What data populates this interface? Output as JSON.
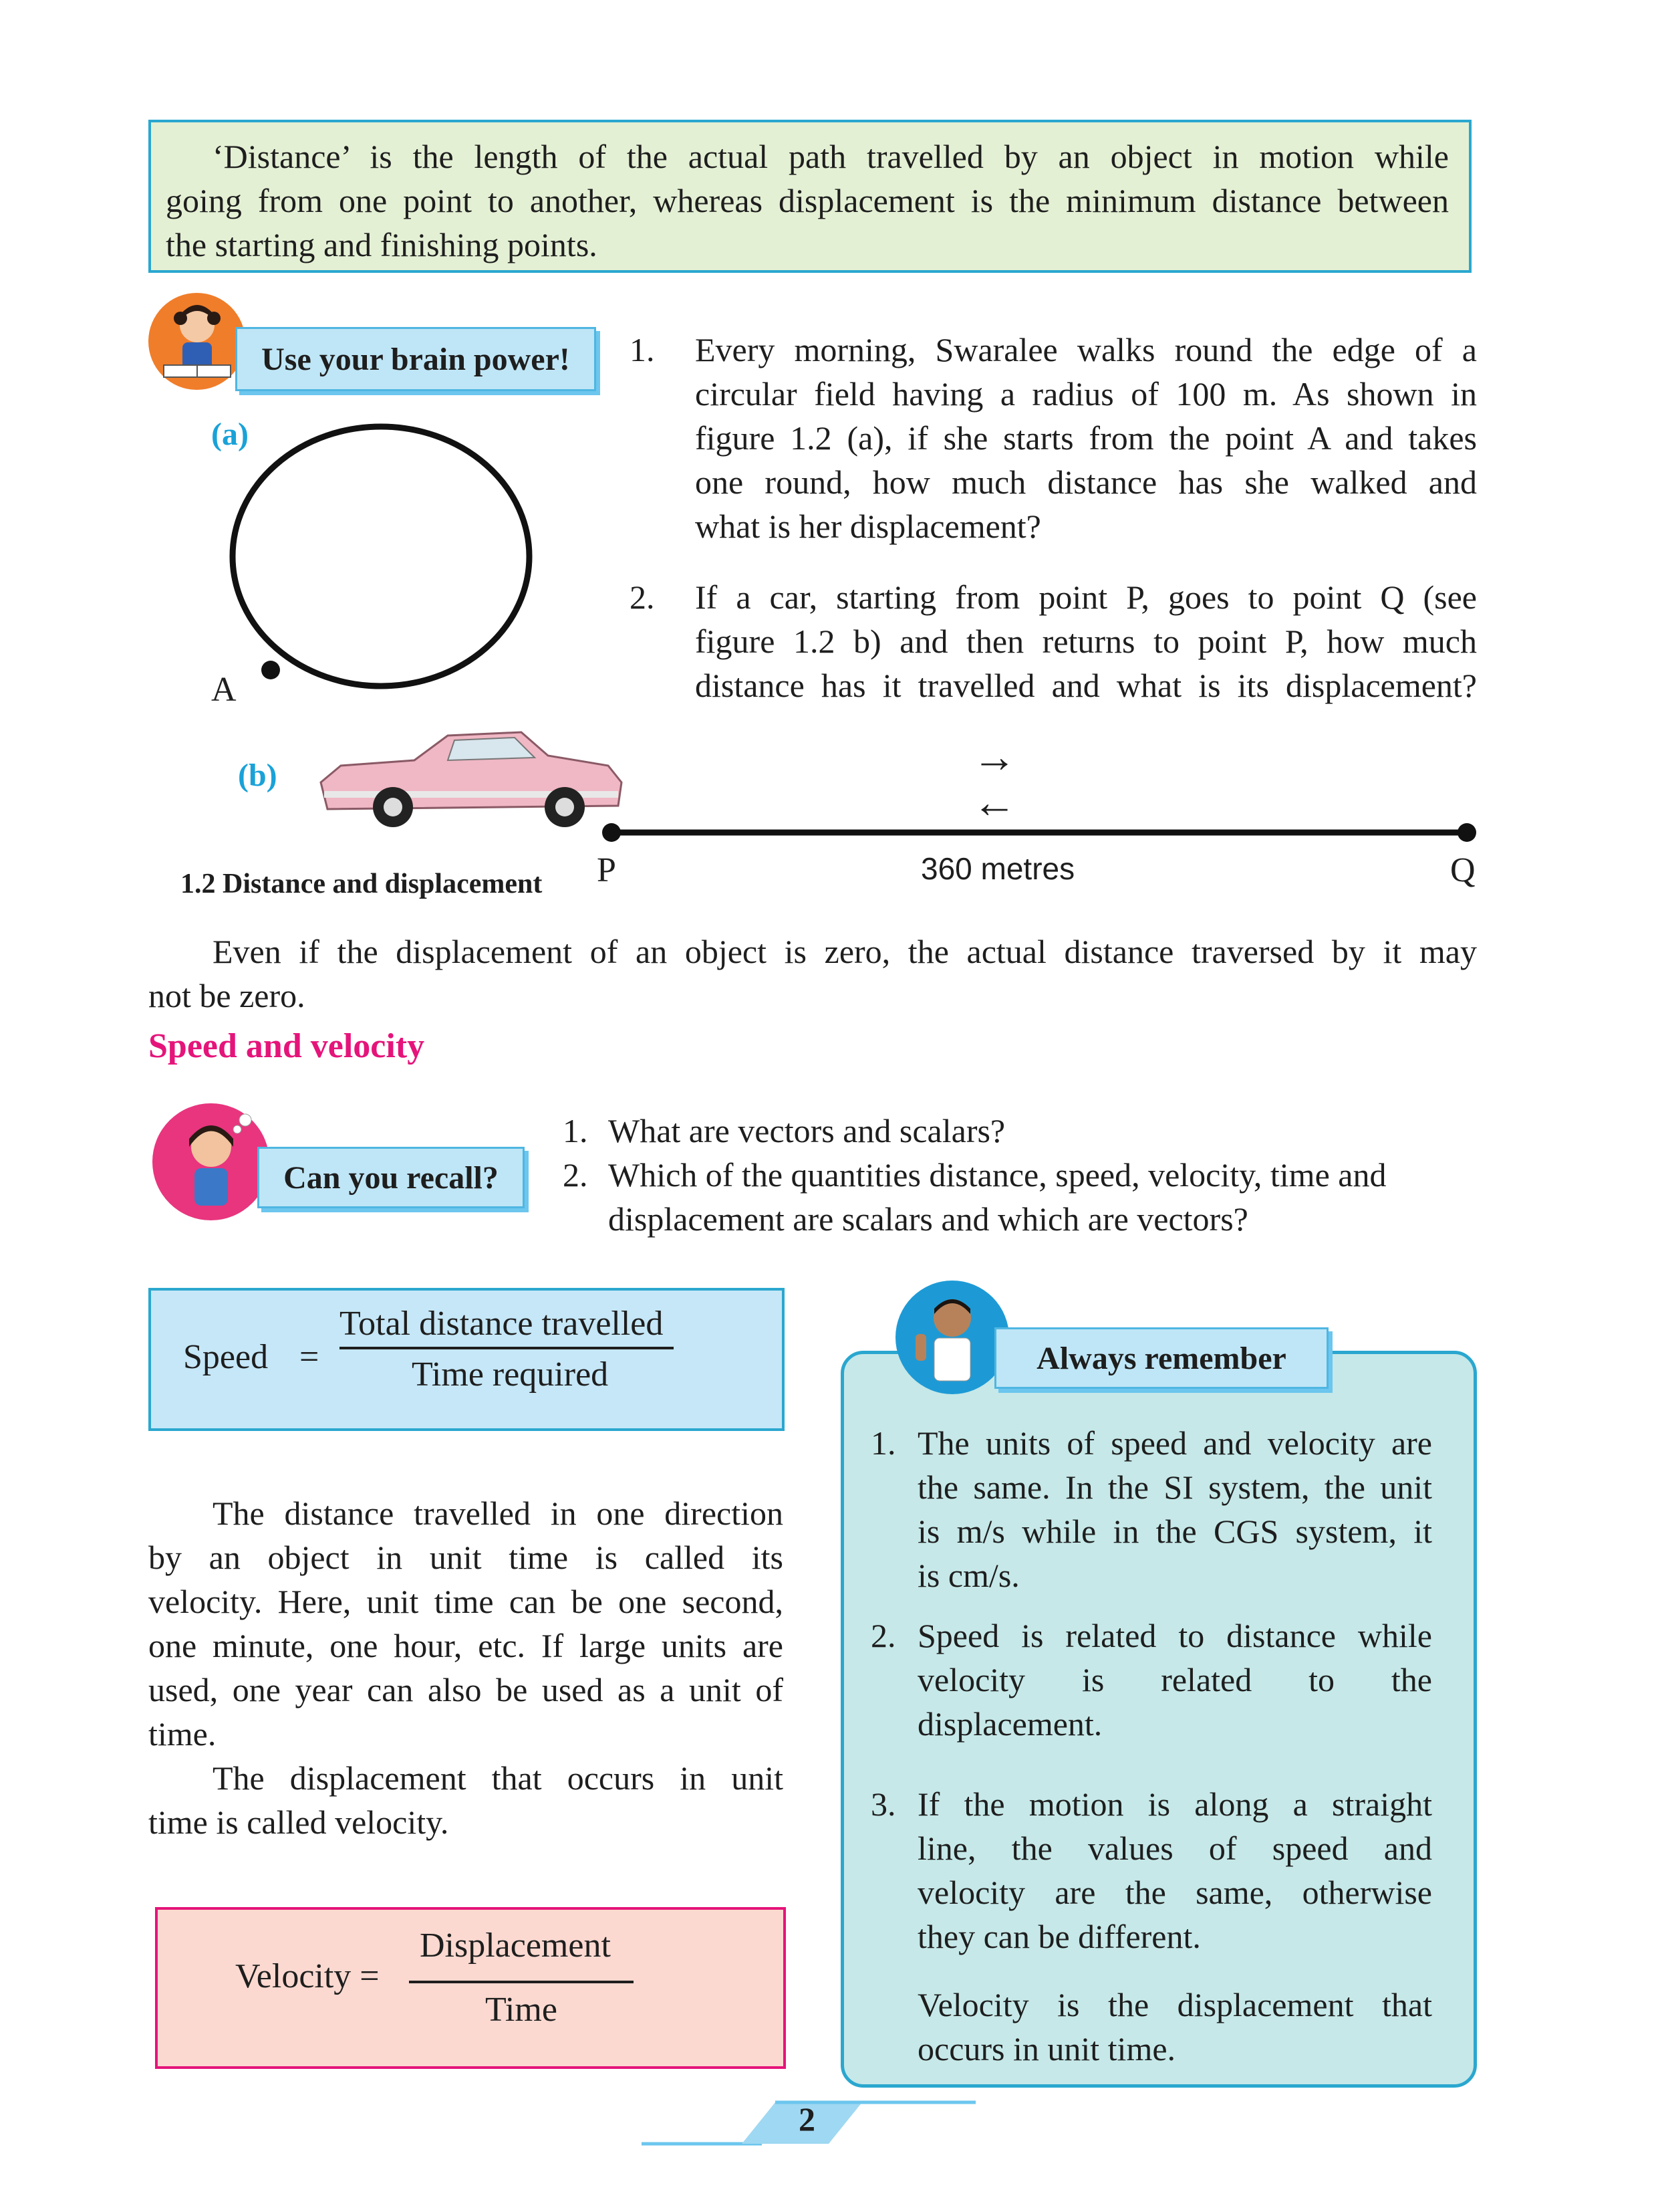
{
  "definition": {
    "line1": "‘Distance’ is the length of the actual path travelled by an object in motion while",
    "line2": "going from one point to another, whereas displacement is the minimum distance between",
    "line3": "the starting and finishing points."
  },
  "brain_power": {
    "tag": "Use your brain power!",
    "questions": [
      {
        "num": "1.",
        "lines": [
          "Every morning, Swaralee walks round the edge of a",
          "circular field having a radius of 100 m. As shown in",
          "figure 1.2 (a), if she starts from the point A and takes",
          "one round, how much distance has she walked and",
          "what is her displacement?"
        ]
      },
      {
        "num": "2.",
        "lines": [
          "If a car, starting from point P, goes to point Q (see",
          "figure 1.2 b) and then returns to point P, how much",
          "distance has it travelled and what is its displacement?"
        ]
      }
    ]
  },
  "figure": {
    "label_a": "(a)",
    "label_b": "(b)",
    "point_a": "A",
    "point_p": "P",
    "point_q": "Q",
    "distance_label": "360 metres",
    "arrow_right": "→",
    "arrow_left": "←",
    "caption": "1.2 Distance and displacement"
  },
  "para_zero": {
    "line1": "Even if the displacement of an object is zero, the actual distance traversed by it may",
    "line2": "not be zero."
  },
  "heading_speed": "Speed and velocity",
  "recall": {
    "tag": "Can you recall?",
    "items": [
      {
        "num": "1.",
        "text": "What are vectors and scalars?"
      },
      {
        "num": "2.",
        "text": "Which of the quantities distance, speed, velocity, time and"
      },
      {
        "num": "",
        "text": "displacement are scalars and which are vectors?"
      }
    ]
  },
  "speed_formula": {
    "lhs": "Speed",
    "eq": "=",
    "numerator": "Total distance travelled",
    "denominator": "Time required"
  },
  "velocity_para": {
    "lines": [
      "The distance travelled in one direction",
      "by an object in unit time is called its",
      "velocity. Here, unit time can be one second,",
      "one minute, one hour, etc. If large units are",
      "used, one year can also be used as a unit of",
      "time."
    ],
    "line2a": "The displacement that occurs in unit",
    "line2b": "time is called velocity."
  },
  "velocity_formula": {
    "lhs": "Velocity =",
    "numerator": "Displacement",
    "denominator": "Time"
  },
  "always_remember": {
    "tag": "Always remember",
    "items": [
      {
        "num": "1.",
        "lines": [
          "The units of speed and velocity are",
          "the same. In the SI system, the unit",
          "is m/s while in the CGS system, it",
          "is cm/s."
        ]
      },
      {
        "num": "2.",
        "lines": [
          "Speed is related to distance while",
          "velocity    is    related    to    the",
          "displacement."
        ]
      },
      {
        "num": "3.",
        "lines": [
          "If the motion is along a straight",
          "line, the values of speed and",
          "velocity are the same, otherwise",
          "they can be different."
        ]
      }
    ],
    "extra": [
      "Velocity is the displacement that",
      "occurs in unit time."
    ]
  },
  "page_number": "2",
  "colors": {
    "accent_blue": "#2aa7cf",
    "heading_pink": "#e5147a",
    "definition_bg": "#e4f0d4",
    "speed_bg": "#c5e7f7",
    "velocity_bg": "#fbd9d0",
    "remember_bg": "#c6e8e8"
  }
}
